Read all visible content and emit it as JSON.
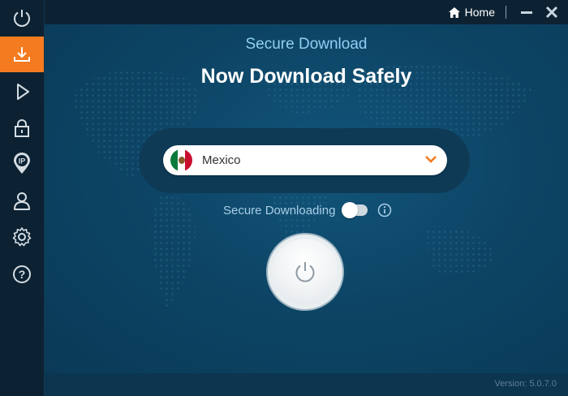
{
  "sidebar": {
    "items": [
      {
        "icon": "power-icon",
        "active": false
      },
      {
        "icon": "download-icon",
        "active": true
      },
      {
        "icon": "play-icon",
        "active": false
      },
      {
        "icon": "lock-icon",
        "active": false
      },
      {
        "icon": "ip-location-icon",
        "active": false,
        "badge": "IP"
      },
      {
        "icon": "user-icon",
        "active": false
      },
      {
        "icon": "gear-icon",
        "active": false
      },
      {
        "icon": "help-icon",
        "active": false,
        "glyph": "?"
      }
    ],
    "accent_color": "#f47b20"
  },
  "titlebar": {
    "home_label": "Home",
    "minimize_icon": "minimize-icon",
    "close_icon": "close-icon"
  },
  "main": {
    "subtitle": "Secure Download",
    "headline": "Now Download Safely",
    "country_select": {
      "value": "Mexico",
      "flag": "mexico-flag",
      "chevron": "chevron-down-icon"
    },
    "toggle": {
      "label": "Secure Downloading",
      "on": false
    },
    "power_button": "power-icon"
  },
  "footer": {
    "version": "Version: 5.0.7.0"
  }
}
